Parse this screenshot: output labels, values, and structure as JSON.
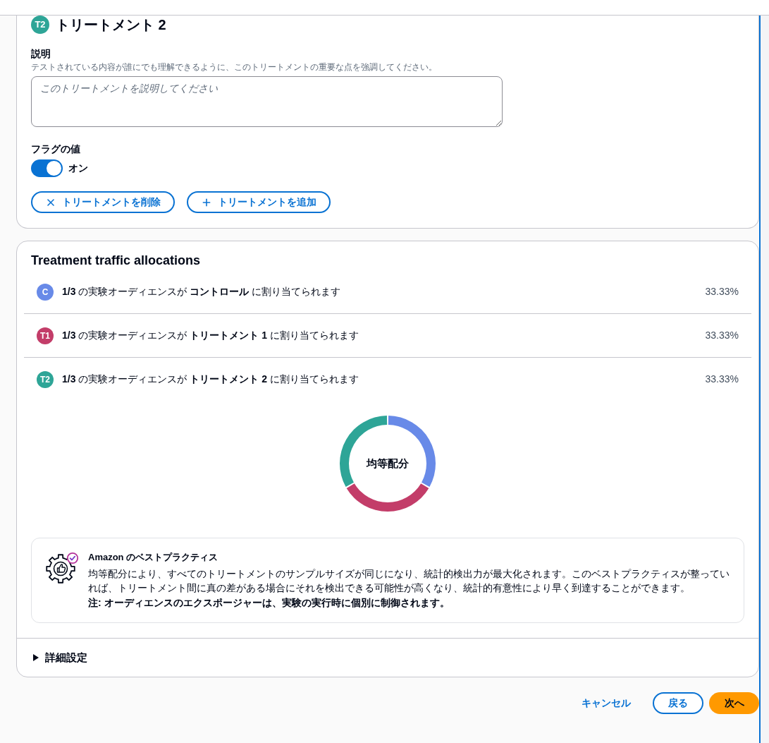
{
  "treatment": {
    "badge": "T2",
    "color": "#2ea597",
    "title": "トリートメント 2",
    "description": {
      "label": "説明",
      "hint": "テストされている内容が誰にでも理解できるように、このトリートメントの重要な点を強調してください。",
      "placeholder": "このトリートメントを説明してください"
    },
    "flag": {
      "label": "フラグの値",
      "on": true,
      "state_label": "オン"
    },
    "actions": [
      {
        "kind": "remove",
        "label": "トリートメントを削除"
      },
      {
        "kind": "add",
        "label": "トリートメントを追加"
      }
    ]
  },
  "allocations": {
    "title": "Treatment traffic allocations",
    "rows": [
      {
        "badge": "C",
        "color": "#688ae8",
        "text": "**1/3** の実験オーディエンスが **コントロール** に割り当てられます",
        "percent": "33.33%"
      },
      {
        "badge": "T1",
        "color": "#c33d69",
        "text": "**1/3** の実験オーディエンスが **トリートメント 1** に割り当てられます",
        "percent": "33.33%"
      },
      {
        "badge": "T2",
        "color": "#2ea597",
        "text": "**1/3** の実験オーディエンスが **トリートメント 2** に割り当てられます",
        "percent": "33.33%"
      }
    ],
    "chart_data": {
      "type": "donut",
      "title": "均等配分",
      "values": [
        33.33,
        33.33,
        33.33
      ]
    },
    "best_practice": {
      "title": "Amazon のベストプラクティス",
      "text": "均等配分により、すべてのトリートメントのサンプルサイズが同じになり、統計的検出力が最大化されます。このベストプラクティスが整っていれば、トリートメント間に真の差がある場合にそれを検出できる可能性が高くなり、統計的有意性により早く到達することができます。",
      "note": "注: オーディエンスのエクスポージャーは、実験の実行時に個別に制御されます。"
    },
    "advanced": {
      "label": "詳細設定",
      "expanded": false
    }
  },
  "footer": {
    "buttons": [
      {
        "kind": "link",
        "label": "キャンセル"
      },
      {
        "kind": "secondary",
        "label": "戻る"
      },
      {
        "kind": "primary",
        "label": "次へ"
      }
    ]
  }
}
